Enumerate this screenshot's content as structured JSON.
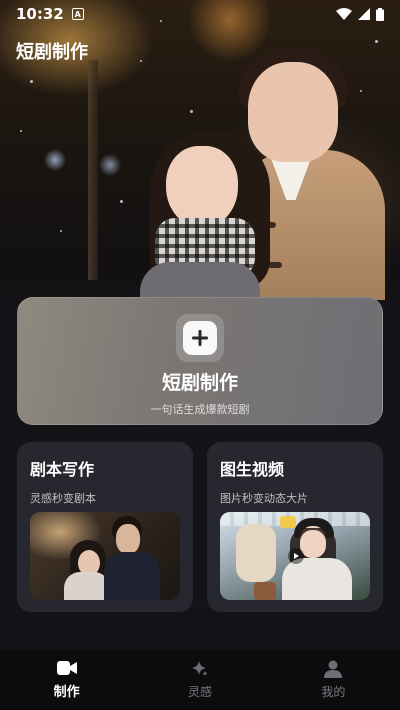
{
  "status_bar": {
    "time": "10:32",
    "indicator": "A"
  },
  "page": {
    "title": "短剧制作"
  },
  "create_card": {
    "title": "短剧制作",
    "subtitle": "一句话生成爆款短剧",
    "icon": "plus-icon"
  },
  "features": [
    {
      "title": "剧本写作",
      "subtitle": "灵感秒变剧本"
    },
    {
      "title": "图生视频",
      "subtitle": "图片秒变动态大片"
    }
  ],
  "bottom_nav": {
    "items": [
      {
        "label": "制作",
        "icon": "video-camera-icon",
        "active": true
      },
      {
        "label": "灵感",
        "icon": "sparkle-icon",
        "active": false
      },
      {
        "label": "我的",
        "icon": "person-icon",
        "active": false
      }
    ]
  },
  "colors": {
    "background": "#141418",
    "card": "#27272f",
    "nav_bg": "#0c0c0e",
    "active": "#ffffff",
    "inactive": "#7a7a80"
  }
}
